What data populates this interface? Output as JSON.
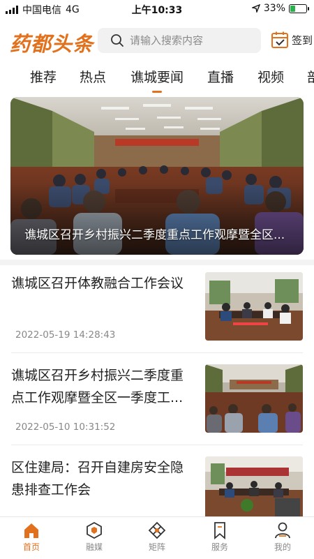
{
  "status_bar": {
    "carrier": "中国电信",
    "network": "4G",
    "time": "上午10:33",
    "battery": "33%",
    "battery_level": 0.33
  },
  "header": {
    "logo_text": "药都头条",
    "search_placeholder": "请输入搜索内容",
    "signin_label": "签到"
  },
  "tabs": [
    {
      "label": "推荐",
      "active": false
    },
    {
      "label": "热点",
      "active": false
    },
    {
      "label": "谯城要闻",
      "active": true
    },
    {
      "label": "直播",
      "active": false
    },
    {
      "label": "视频",
      "active": false
    },
    {
      "label": "部",
      "active": false
    }
  ],
  "hero": {
    "caption": "谯城区召开乡村振兴二季度重点工作观摩暨全区..."
  },
  "news": [
    {
      "title": "谯城区召开体教融合工作会议",
      "date": "2022-05-19 14:28:43"
    },
    {
      "title": "谯城区召开乡村振兴二季度重点工作观摩暨全区一季度工...",
      "date": "2022-05-10 10:31:52"
    },
    {
      "title": "区住建局：召开自建房安全隐患排查工作会",
      "date": ""
    }
  ],
  "bottom_nav": [
    {
      "label": "首页",
      "icon": "home-icon",
      "active": true
    },
    {
      "label": "融媒",
      "icon": "media-hexagon-icon",
      "active": false
    },
    {
      "label": "矩阵",
      "icon": "matrix-icon",
      "active": false
    },
    {
      "label": "服务",
      "icon": "bookmark-icon",
      "active": false
    },
    {
      "label": "我的",
      "icon": "user-icon",
      "active": false
    }
  ],
  "colors": {
    "accent": "#e2711d",
    "text": "#222222",
    "muted": "#888888"
  }
}
